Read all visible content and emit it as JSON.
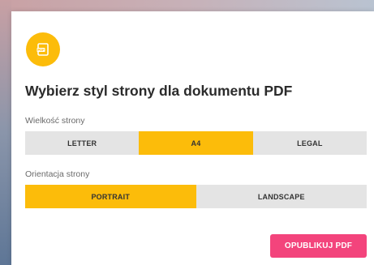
{
  "colors": {
    "accent": "#fcbc0a",
    "primary_button": "#f3447c",
    "segment_bg": "#e4e4e4",
    "title_text": "#2b2b2b"
  },
  "dialog": {
    "icon": "pdf-document-icon",
    "title": "Wybierz styl strony dla dokumentu PDF",
    "page_size": {
      "label": "Wielkość strony",
      "options": [
        "LETTER",
        "A4",
        "LEGAL"
      ],
      "selected": "A4"
    },
    "orientation": {
      "label": "Orientacja strony",
      "options": [
        "PORTRAIT",
        "LANDSCAPE"
      ],
      "selected": "PORTRAIT"
    },
    "publish_label": "OPUBLIKUJ PDF"
  }
}
